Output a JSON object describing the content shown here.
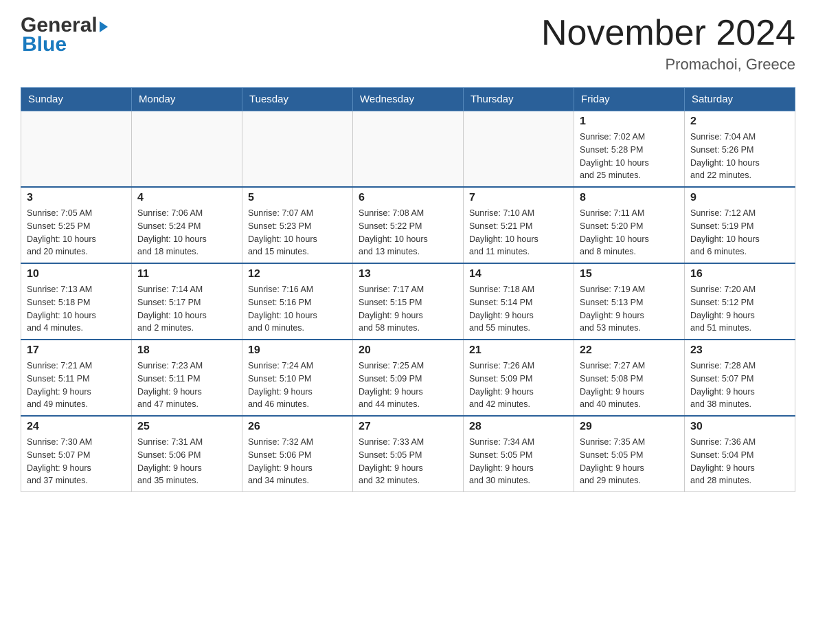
{
  "logo": {
    "general": "General",
    "blue": "Blue"
  },
  "title": "November 2024",
  "subtitle": "Promachoi, Greece",
  "days_header": [
    "Sunday",
    "Monday",
    "Tuesday",
    "Wednesday",
    "Thursday",
    "Friday",
    "Saturday"
  ],
  "weeks": [
    [
      {
        "day": "",
        "info": ""
      },
      {
        "day": "",
        "info": ""
      },
      {
        "day": "",
        "info": ""
      },
      {
        "day": "",
        "info": ""
      },
      {
        "day": "",
        "info": ""
      },
      {
        "day": "1",
        "info": "Sunrise: 7:02 AM\nSunset: 5:28 PM\nDaylight: 10 hours\nand 25 minutes."
      },
      {
        "day": "2",
        "info": "Sunrise: 7:04 AM\nSunset: 5:26 PM\nDaylight: 10 hours\nand 22 minutes."
      }
    ],
    [
      {
        "day": "3",
        "info": "Sunrise: 7:05 AM\nSunset: 5:25 PM\nDaylight: 10 hours\nand 20 minutes."
      },
      {
        "day": "4",
        "info": "Sunrise: 7:06 AM\nSunset: 5:24 PM\nDaylight: 10 hours\nand 18 minutes."
      },
      {
        "day": "5",
        "info": "Sunrise: 7:07 AM\nSunset: 5:23 PM\nDaylight: 10 hours\nand 15 minutes."
      },
      {
        "day": "6",
        "info": "Sunrise: 7:08 AM\nSunset: 5:22 PM\nDaylight: 10 hours\nand 13 minutes."
      },
      {
        "day": "7",
        "info": "Sunrise: 7:10 AM\nSunset: 5:21 PM\nDaylight: 10 hours\nand 11 minutes."
      },
      {
        "day": "8",
        "info": "Sunrise: 7:11 AM\nSunset: 5:20 PM\nDaylight: 10 hours\nand 8 minutes."
      },
      {
        "day": "9",
        "info": "Sunrise: 7:12 AM\nSunset: 5:19 PM\nDaylight: 10 hours\nand 6 minutes."
      }
    ],
    [
      {
        "day": "10",
        "info": "Sunrise: 7:13 AM\nSunset: 5:18 PM\nDaylight: 10 hours\nand 4 minutes."
      },
      {
        "day": "11",
        "info": "Sunrise: 7:14 AM\nSunset: 5:17 PM\nDaylight: 10 hours\nand 2 minutes."
      },
      {
        "day": "12",
        "info": "Sunrise: 7:16 AM\nSunset: 5:16 PM\nDaylight: 10 hours\nand 0 minutes."
      },
      {
        "day": "13",
        "info": "Sunrise: 7:17 AM\nSunset: 5:15 PM\nDaylight: 9 hours\nand 58 minutes."
      },
      {
        "day": "14",
        "info": "Sunrise: 7:18 AM\nSunset: 5:14 PM\nDaylight: 9 hours\nand 55 minutes."
      },
      {
        "day": "15",
        "info": "Sunrise: 7:19 AM\nSunset: 5:13 PM\nDaylight: 9 hours\nand 53 minutes."
      },
      {
        "day": "16",
        "info": "Sunrise: 7:20 AM\nSunset: 5:12 PM\nDaylight: 9 hours\nand 51 minutes."
      }
    ],
    [
      {
        "day": "17",
        "info": "Sunrise: 7:21 AM\nSunset: 5:11 PM\nDaylight: 9 hours\nand 49 minutes."
      },
      {
        "day": "18",
        "info": "Sunrise: 7:23 AM\nSunset: 5:11 PM\nDaylight: 9 hours\nand 47 minutes."
      },
      {
        "day": "19",
        "info": "Sunrise: 7:24 AM\nSunset: 5:10 PM\nDaylight: 9 hours\nand 46 minutes."
      },
      {
        "day": "20",
        "info": "Sunrise: 7:25 AM\nSunset: 5:09 PM\nDaylight: 9 hours\nand 44 minutes."
      },
      {
        "day": "21",
        "info": "Sunrise: 7:26 AM\nSunset: 5:09 PM\nDaylight: 9 hours\nand 42 minutes."
      },
      {
        "day": "22",
        "info": "Sunrise: 7:27 AM\nSunset: 5:08 PM\nDaylight: 9 hours\nand 40 minutes."
      },
      {
        "day": "23",
        "info": "Sunrise: 7:28 AM\nSunset: 5:07 PM\nDaylight: 9 hours\nand 38 minutes."
      }
    ],
    [
      {
        "day": "24",
        "info": "Sunrise: 7:30 AM\nSunset: 5:07 PM\nDaylight: 9 hours\nand 37 minutes."
      },
      {
        "day": "25",
        "info": "Sunrise: 7:31 AM\nSunset: 5:06 PM\nDaylight: 9 hours\nand 35 minutes."
      },
      {
        "day": "26",
        "info": "Sunrise: 7:32 AM\nSunset: 5:06 PM\nDaylight: 9 hours\nand 34 minutes."
      },
      {
        "day": "27",
        "info": "Sunrise: 7:33 AM\nSunset: 5:05 PM\nDaylight: 9 hours\nand 32 minutes."
      },
      {
        "day": "28",
        "info": "Sunrise: 7:34 AM\nSunset: 5:05 PM\nDaylight: 9 hours\nand 30 minutes."
      },
      {
        "day": "29",
        "info": "Sunrise: 7:35 AM\nSunset: 5:05 PM\nDaylight: 9 hours\nand 29 minutes."
      },
      {
        "day": "30",
        "info": "Sunrise: 7:36 AM\nSunset: 5:04 PM\nDaylight: 9 hours\nand 28 minutes."
      }
    ]
  ]
}
